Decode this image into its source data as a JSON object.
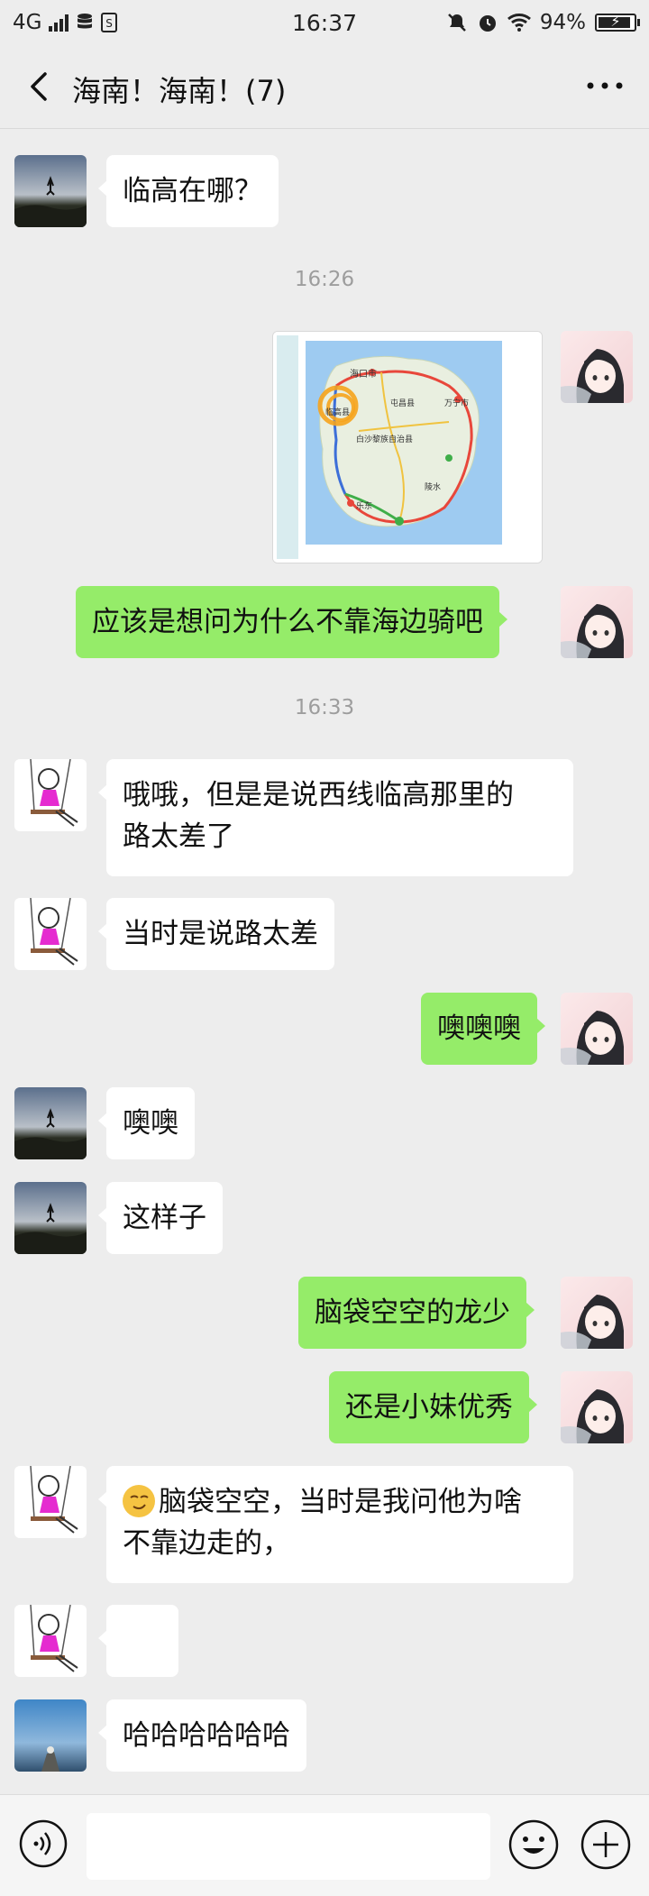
{
  "status_bar": {
    "network": "4G",
    "time": "16:37",
    "battery": "94%"
  },
  "header": {
    "title": "海南！海南！(7)"
  },
  "messages": [
    {
      "type": "text",
      "side": "in",
      "avatar": "sky-silhouette-avatar",
      "text": "临高在哪？"
    },
    {
      "type": "time",
      "text": "16:26"
    },
    {
      "type": "image",
      "side": "out",
      "avatar": "anime-girl-avatar",
      "map_labels": [
        "海口市",
        "临高县",
        "屯昌县",
        "万宁市",
        "白沙黎族自治县",
        "陵水",
        "乐东"
      ]
    },
    {
      "type": "text",
      "side": "out",
      "avatar": "anime-girl-avatar",
      "text": "应该是想问为什么不靠海边骑吧"
    },
    {
      "type": "time",
      "text": "16:33"
    },
    {
      "type": "text",
      "side": "in",
      "avatar": "swing-cartoon-avatar",
      "text": "哦哦，但是是说西线临高那里的\n路太差了"
    },
    {
      "type": "text",
      "side": "in",
      "avatar": "swing-cartoon-avatar",
      "text": "当时是说路太差"
    },
    {
      "type": "text",
      "side": "out",
      "avatar": "anime-girl-avatar",
      "text": "噢噢噢"
    },
    {
      "type": "text",
      "side": "in",
      "avatar": "sky-silhouette-avatar",
      "text": "噢噢"
    },
    {
      "type": "text",
      "side": "in",
      "avatar": "sky-silhouette-avatar",
      "text": "这样子"
    },
    {
      "type": "text",
      "side": "out",
      "avatar": "anime-girl-avatar",
      "text": "脑袋空空的龙少"
    },
    {
      "type": "text",
      "side": "out",
      "avatar": "anime-girl-avatar",
      "text": "还是小妹优秀"
    },
    {
      "type": "text",
      "side": "in",
      "avatar": "swing-cartoon-avatar",
      "emoji": "smirk-emoji",
      "text": "脑袋空空，当时是我问他为啥\n不靠边走的，"
    },
    {
      "type": "emoji",
      "side": "in",
      "avatar": "swing-cartoon-avatar",
      "emoji": "sweat-emoji"
    },
    {
      "type": "text",
      "side": "in",
      "avatar": "sea-sky-avatar",
      "text": "哈哈哈哈哈哈"
    }
  ],
  "input_bar": {
    "placeholder": ""
  },
  "colors": {
    "background": "#ededed",
    "outgoing_bubble": "#95ec69",
    "incoming_bubble": "#ffffff",
    "timestamp": "#9d9d9d"
  }
}
